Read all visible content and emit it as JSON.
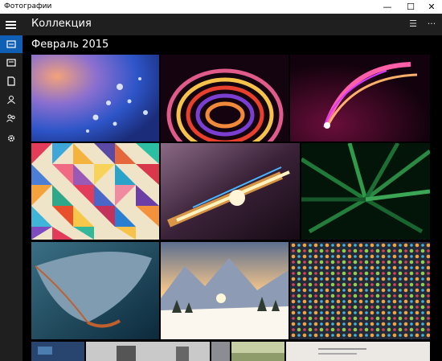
{
  "window": {
    "title": "Фотографии",
    "minimize_glyph": "—",
    "maximize_glyph": "☐",
    "close_glyph": "✕"
  },
  "appbar": {
    "title": "Коллекция",
    "select_glyph": "☰",
    "more_glyph": "···",
    "hamburger_icon": "hamburger-icon"
  },
  "sidebar": {
    "items": [
      {
        "id": "collection",
        "icon": "collection-icon",
        "active": true
      },
      {
        "id": "albums",
        "icon": "albums-icon",
        "active": false
      },
      {
        "id": "folders",
        "icon": "folders-icon",
        "active": false
      },
      {
        "id": "people",
        "icon": "people-icon",
        "active": false
      },
      {
        "id": "shared",
        "icon": "shared-icon",
        "active": false
      },
      {
        "id": "settings",
        "icon": "gear-icon",
        "active": false
      }
    ]
  },
  "collection": {
    "section_title": "Февраль 2015",
    "photos": [
      "water-drops-photo",
      "neon-swirl-photo",
      "light-streak-photo",
      "color-mosaic-photo",
      "light-explosion-photo",
      "green-leaves-photo",
      "frozen-leaf-photo",
      "snowy-mountains-photo",
      "colorful-pattern-photo",
      "partial-photo-1",
      "partial-photo-2",
      "partial-photo-3",
      "partial-photo-4",
      "partial-photo-5"
    ]
  },
  "colors": {
    "accent": "#0f5fb5",
    "bar": "#1f1f1f",
    "background": "#000000"
  }
}
